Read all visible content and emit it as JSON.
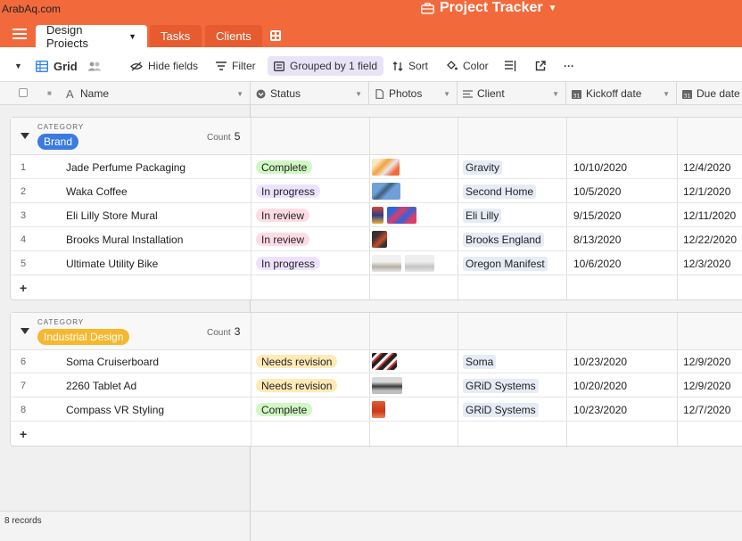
{
  "watermark": "ArabAq.com",
  "app": {
    "title": "Project Tracker"
  },
  "tabs": [
    {
      "label": "Design Projects",
      "active": true
    },
    {
      "label": "Tasks"
    },
    {
      "label": "Clients"
    }
  ],
  "toolbar": {
    "view_name": "Grid",
    "hide_fields": "Hide fields",
    "filter": "Filter",
    "grouped": "Grouped by 1 field",
    "sort": "Sort",
    "color": "Color",
    "more": "···"
  },
  "columns": {
    "name": "Name",
    "status": "Status",
    "photos": "Photos",
    "client": "Client",
    "kickoff": "Kickoff date",
    "due": "Due date"
  },
  "groups": [
    {
      "category_label": "CATEGORY",
      "name": "Brand",
      "color": "#3b7be0",
      "count_label": "Count",
      "count": "5",
      "rows": [
        {
          "num": "1",
          "name": "Jade Perfume Packaging",
          "status": "Complete",
          "status_bg": "#d1f7c4",
          "client": "Gravity",
          "kickoff": "10/10/2020",
          "due": "12/4/2020",
          "photos": [
            "photo-1"
          ]
        },
        {
          "num": "2",
          "name": "Waka Coffee",
          "status": "In progress",
          "status_bg": "#ede2fe",
          "client": "Second Home",
          "kickoff": "10/5/2020",
          "due": "12/1/2020",
          "photos": [
            "photo-2"
          ]
        },
        {
          "num": "3",
          "name": "Eli Lilly Store Mural",
          "status": "In review",
          "status_bg": "#ffdce5",
          "client": "Eli Lilly",
          "kickoff": "9/15/2020",
          "due": "12/11/2020",
          "photos": [
            "photo-3a",
            "photo-3b"
          ]
        },
        {
          "num": "4",
          "name": "Brooks Mural Installation",
          "status": "In review",
          "status_bg": "#ffdce5",
          "client": "Brooks England",
          "kickoff": "8/13/2020",
          "due": "12/22/2020",
          "photos": [
            "photo-4"
          ]
        },
        {
          "num": "5",
          "name": "Ultimate Utility Bike",
          "status": "In progress",
          "status_bg": "#ede2fe",
          "client": "Oregon Manifest",
          "kickoff": "10/6/2020",
          "due": "12/3/2020",
          "photos": [
            "photo-5a",
            "photo-5b"
          ]
        }
      ]
    },
    {
      "category_label": "CATEGORY",
      "name": "Industrial Design",
      "color": "#f5b82e",
      "count_label": "Count",
      "count": "3",
      "rows": [
        {
          "num": "6",
          "name": "Soma Cruiserboard",
          "status": "Needs revision",
          "status_bg": "#ffeab6",
          "client": "Soma",
          "kickoff": "10/23/2020",
          "due": "12/9/2020",
          "photos": [
            "photo-6"
          ]
        },
        {
          "num": "7",
          "name": "2260 Tablet Ad",
          "status": "Needs revision",
          "status_bg": "#ffeab6",
          "client": "GRiD Systems",
          "kickoff": "10/20/2020",
          "due": "12/9/2020",
          "photos": [
            "photo-7"
          ]
        },
        {
          "num": "8",
          "name": "Compass VR Styling",
          "status": "Complete",
          "status_bg": "#d1f7c4",
          "client": "GRiD Systems",
          "kickoff": "10/23/2020",
          "due": "12/7/2020",
          "photos": [
            "photo-8"
          ]
        }
      ]
    }
  ],
  "footer": {
    "records": "8 records"
  }
}
